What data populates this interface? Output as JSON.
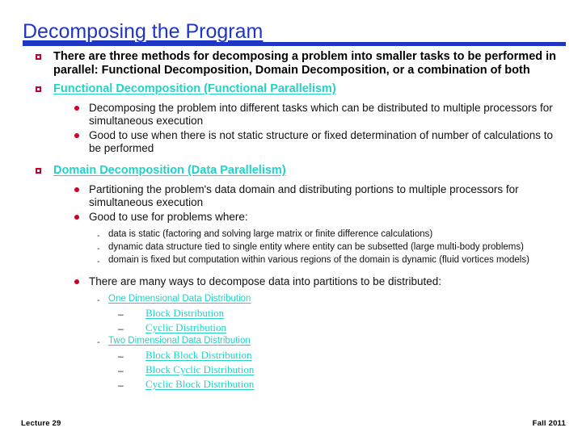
{
  "slide": {
    "title": "Decomposing the Program",
    "title_color": "#1f35c4",
    "accent_bar_color": "#1f35c4",
    "link_color": "#1fd3c6",
    "bullet_color": "#c00030"
  },
  "content": {
    "b1": {
      "marker": "square-hollow",
      "text": "There are three methods for decomposing a problem into smaller tasks to be performed in parallel: Functional Decomposition, Domain Decomposition, or a combination of both"
    },
    "b2": {
      "marker": "square-hollow",
      "text": "Functional Decomposition (Functional Parallelism)",
      "is_link": true
    },
    "b2_sub": [
      {
        "marker": "dot",
        "text": "Decomposing the problem into different tasks which can be distributed to multiple processors for simultaneous execution"
      },
      {
        "marker": "dot",
        "text": "Good to use when there is not static structure or fixed determination of number of calculations to be performed"
      }
    ],
    "b3": {
      "marker": "square-hollow",
      "text": "Domain Decomposition (Data Parallelism)",
      "is_link": true
    },
    "b3_sub": [
      {
        "marker": "dot",
        "text": "Partitioning the problem's data domain and distributing portions to multiple processors for simultaneous execution"
      },
      {
        "marker": "dot",
        "text": "Good to use for problems where:"
      }
    ],
    "b3_sub_dashes": [
      {
        "marker": "-",
        "text": "data is static (factoring and solving large matrix or finite difference calculations)"
      },
      {
        "marker": "-",
        "text": "dynamic data structure tied to single entity where entity can be subsetted (large multi-body problems)"
      },
      {
        "marker": "-",
        "text": "domain is fixed but computation within various regions of the domain is dynamic (fluid vortices models)"
      }
    ],
    "b4": {
      "marker": "dot",
      "text": "There are many ways to decompose data into partitions to be distributed:"
    },
    "distribution_links": [
      {
        "level": 3,
        "marker": "-",
        "text": "One Dimensional Data Distribution"
      },
      {
        "level": 4,
        "marker": "–",
        "text": "Block Distribution"
      },
      {
        "level": 4,
        "marker": "–",
        "text": "Cyclic Distribution"
      },
      {
        "level": 3,
        "marker": "-",
        "text": "Two Dimensional Data Distribution"
      },
      {
        "level": 4,
        "marker": "–",
        "text": "Block Block Distribution"
      },
      {
        "level": 4,
        "marker": "–",
        "text": "Block Cyclic Distribution"
      },
      {
        "level": 4,
        "marker": "–",
        "text": "Cyclic Block Distribution"
      }
    ]
  },
  "footer": {
    "left": "Lecture 29",
    "right": "Fall 2011"
  }
}
